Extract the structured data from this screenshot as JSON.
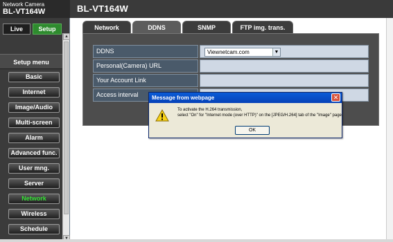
{
  "header": {
    "camera_label": "Network Camera",
    "camera_model": "BL-VT164W",
    "model_title": "BL-VT164W"
  },
  "sidebar": {
    "live_label": "Live",
    "setup_label": "Setup",
    "setup_menu_title": "Setup menu",
    "items": [
      {
        "label": "Basic"
      },
      {
        "label": "Internet"
      },
      {
        "label": "Image/Audio"
      },
      {
        "label": "Multi-screen"
      },
      {
        "label": "Alarm"
      },
      {
        "label": "Advanced func."
      },
      {
        "label": "User mng."
      },
      {
        "label": "Server"
      },
      {
        "label": "Network"
      },
      {
        "label": "Wireless"
      },
      {
        "label": "Schedule"
      }
    ],
    "active_item": "Network"
  },
  "tabs": [
    {
      "label": "Network"
    },
    {
      "label": "DDNS"
    },
    {
      "label": "SNMP"
    },
    {
      "label": "FTP img. trans."
    }
  ],
  "active_tab": "DDNS",
  "ddns_form": {
    "ddns_label": "DDNS",
    "ddns_value": "Viewnetcam.com",
    "personal_url_label": "Personal(Camera) URL",
    "account_link_label": "Your Account Link",
    "access_interval_label": "Access interval"
  },
  "dialog": {
    "title": "Message from webpage",
    "message_line1": "To activate the H.264 transmission,",
    "message_line2": "select \"On\" for \"Internet mode (over HTTP)\" on the [JPEG/H.264] tab of the \"Image\" page.",
    "ok_label": "OK",
    "close_symbol": "✕",
    "icon": "warning-icon"
  },
  "colors": {
    "setup_green": "#2e8b2e",
    "active_menu_text": "#35e035",
    "dialog_titlebar": "#0a5bd6",
    "panel_bg": "#4d4d4d"
  }
}
